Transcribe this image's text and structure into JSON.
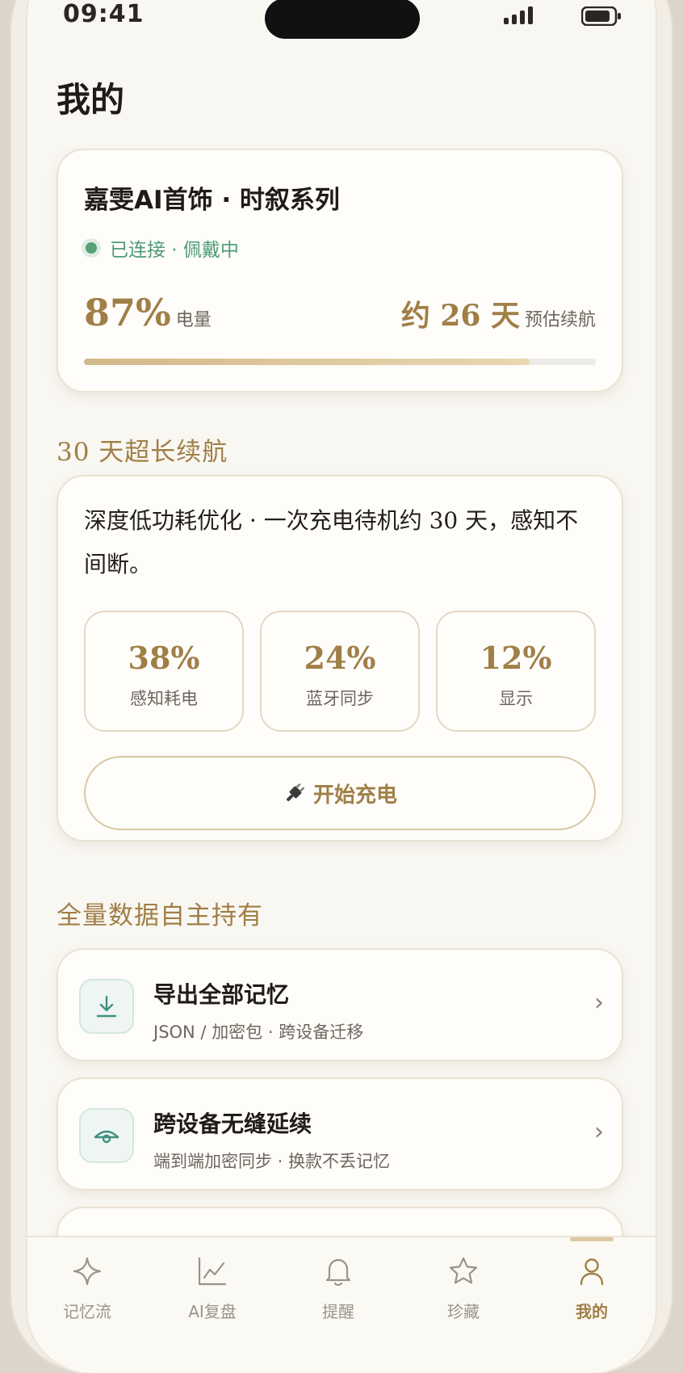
{
  "status": {
    "time": "09:41"
  },
  "page": {
    "title": "我的"
  },
  "device": {
    "name": "嘉雯AI首饰 · 时叙系列",
    "connection": "已连接 · 佩戴中",
    "battery_value": "87%",
    "battery_label": "电量",
    "battery_level": 0.87,
    "endurance_value": "约 26 天",
    "endurance_label": "预估续航"
  },
  "endurance": {
    "title": "30 天超长续航",
    "description": "深度低功耗优化 · 一次充电待机约 30 天，感知不间断。",
    "stats": [
      {
        "value": "38%",
        "label": "感知耗电"
      },
      {
        "value": "24%",
        "label": "蓝牙同步"
      },
      {
        "value": "12%",
        "label": "显示"
      }
    ],
    "charge_label": "开始充电"
  },
  "data_section": {
    "title": "全量数据自主持有",
    "items": [
      {
        "title": "导出全部记忆",
        "subtitle": "JSON / 加密包 · 跨设备迁移",
        "icon": "download-icon"
      },
      {
        "title": "跨设备无缝延续",
        "subtitle": "端到端加密同步 · 换款不丢记忆",
        "icon": "sync-icon"
      }
    ]
  },
  "tabbar": {
    "items": [
      {
        "label": "记忆流",
        "icon": "sparkle-icon"
      },
      {
        "label": "AI复盘",
        "icon": "chart-icon"
      },
      {
        "label": "提醒",
        "icon": "bell-icon"
      },
      {
        "label": "珍藏",
        "icon": "star-icon"
      },
      {
        "label": "我的",
        "icon": "person-icon"
      }
    ],
    "active": "我的"
  },
  "colors": {
    "accent": "#a07f46",
    "connected": "#4f9a74",
    "background": "#f9f7f2",
    "icon_tint": "#3f8f82"
  }
}
